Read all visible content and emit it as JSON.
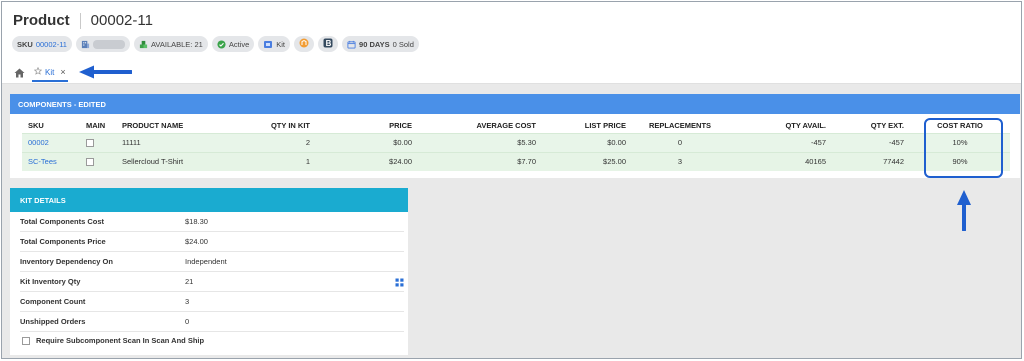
{
  "header": {
    "title": "Product",
    "code": "00002-11",
    "chips": {
      "sku_label": "SKU",
      "sku_value": "00002-11",
      "available": "AVAILABLE: 21",
      "active": "Active",
      "kit": "Kit",
      "days_bold": "90 DAYS",
      "days_rest": "0 Sold"
    }
  },
  "tabs": {
    "kit_label": "Kit",
    "close": "×"
  },
  "components": {
    "title": "COMPONENTS - EDITED",
    "columns": [
      "SKU",
      "MAIN",
      "PRODUCT NAME",
      "QTY IN KIT",
      "PRICE",
      "AVERAGE COST",
      "LIST PRICE",
      "REPLACEMENTS",
      "QTY AVAIL.",
      "QTY EXT.",
      "COST RATIO"
    ],
    "rows": [
      {
        "sku": "00002",
        "name": "11111",
        "qty_in_kit": "2",
        "price": "$0.00",
        "avg_cost": "$5.30",
        "list_price": "$0.00",
        "replacements": "0",
        "qty_avail": "-457",
        "qty_ext": "-457",
        "cost_ratio": "10%"
      },
      {
        "sku": "SC-Tees",
        "name": "Sellercloud T-Shirt",
        "qty_in_kit": "1",
        "price": "$24.00",
        "avg_cost": "$7.70",
        "list_price": "$25.00",
        "replacements": "3",
        "qty_avail": "40165",
        "qty_ext": "77442",
        "cost_ratio": "90%"
      }
    ]
  },
  "kit_details": {
    "title": "KIT DETAILS",
    "rows": [
      {
        "label": "Total Components Cost",
        "value": "$18.30"
      },
      {
        "label": "Total Components Price",
        "value": "$24.00"
      },
      {
        "label": "Inventory Dependency On",
        "value": "Independent"
      },
      {
        "label": "Kit Inventory Qty",
        "value": "21"
      },
      {
        "label": "Component Count",
        "value": "3"
      },
      {
        "label": "Unshipped Orders",
        "value": "0"
      }
    ],
    "checkbox_label": "Require Subcomponent Scan In Scan And Ship"
  },
  "colors": {
    "accent_blue": "#4a90e8",
    "kit_header": "#1aabd0",
    "annotation": "#1f5fcf",
    "row_green": "#e8f5e9"
  }
}
